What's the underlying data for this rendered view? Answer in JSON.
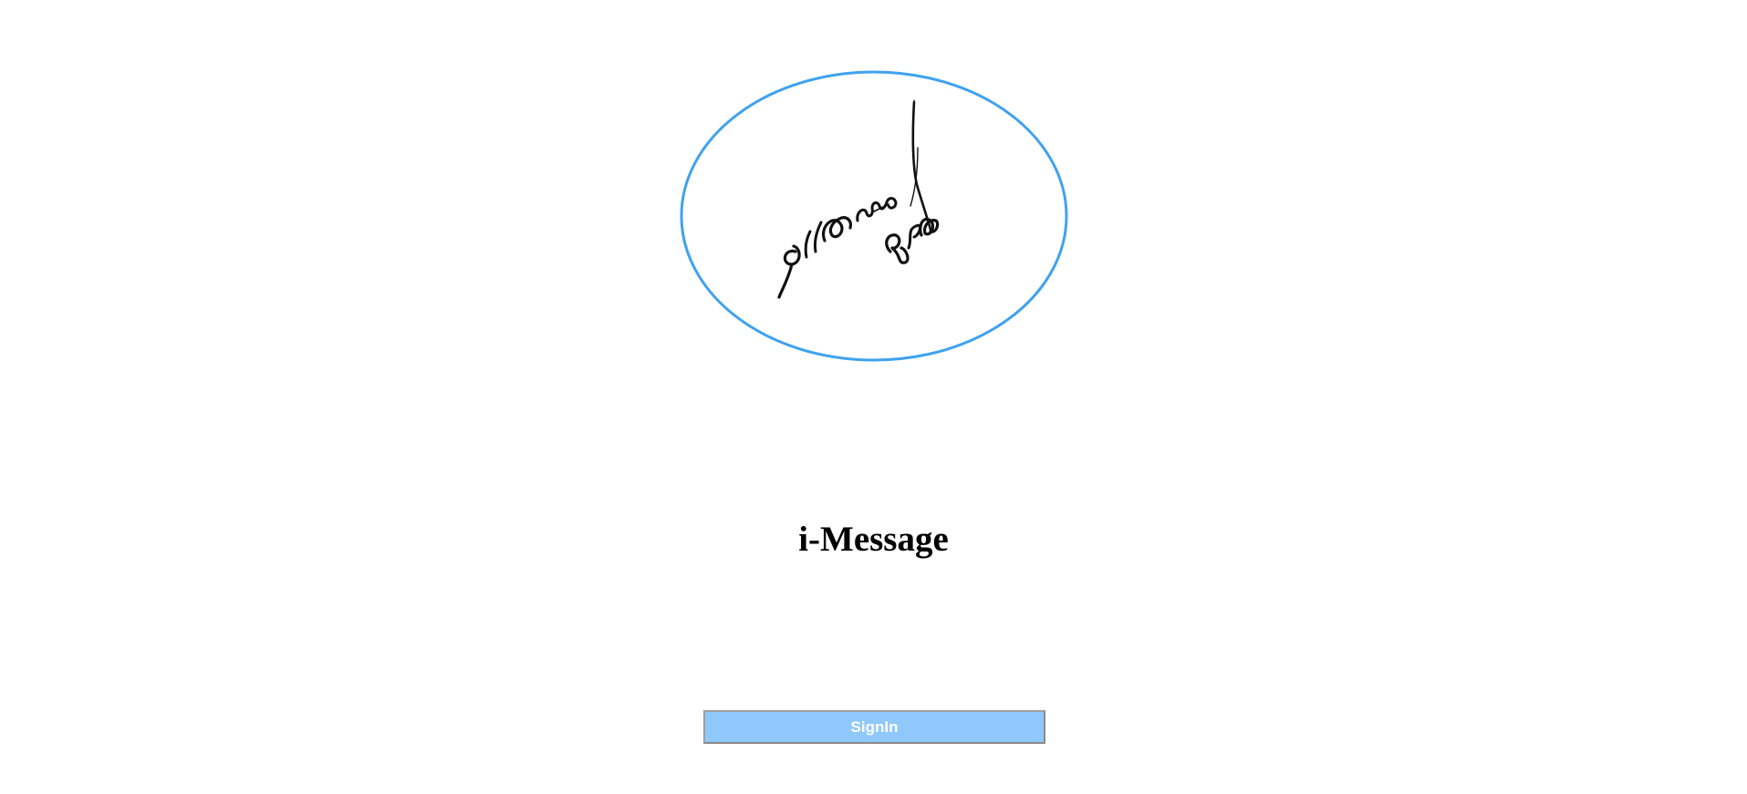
{
  "logo": {
    "signature_text": "ऽ।ऽ।ऽ"
  },
  "app": {
    "title": "i-Message"
  },
  "actions": {
    "signin_label": "SignIn"
  },
  "colors": {
    "logo_ring": "#3fa2ef",
    "signin_background": "#8fc9fb",
    "signin_text": "#ffffff",
    "title_text": "#000000"
  }
}
